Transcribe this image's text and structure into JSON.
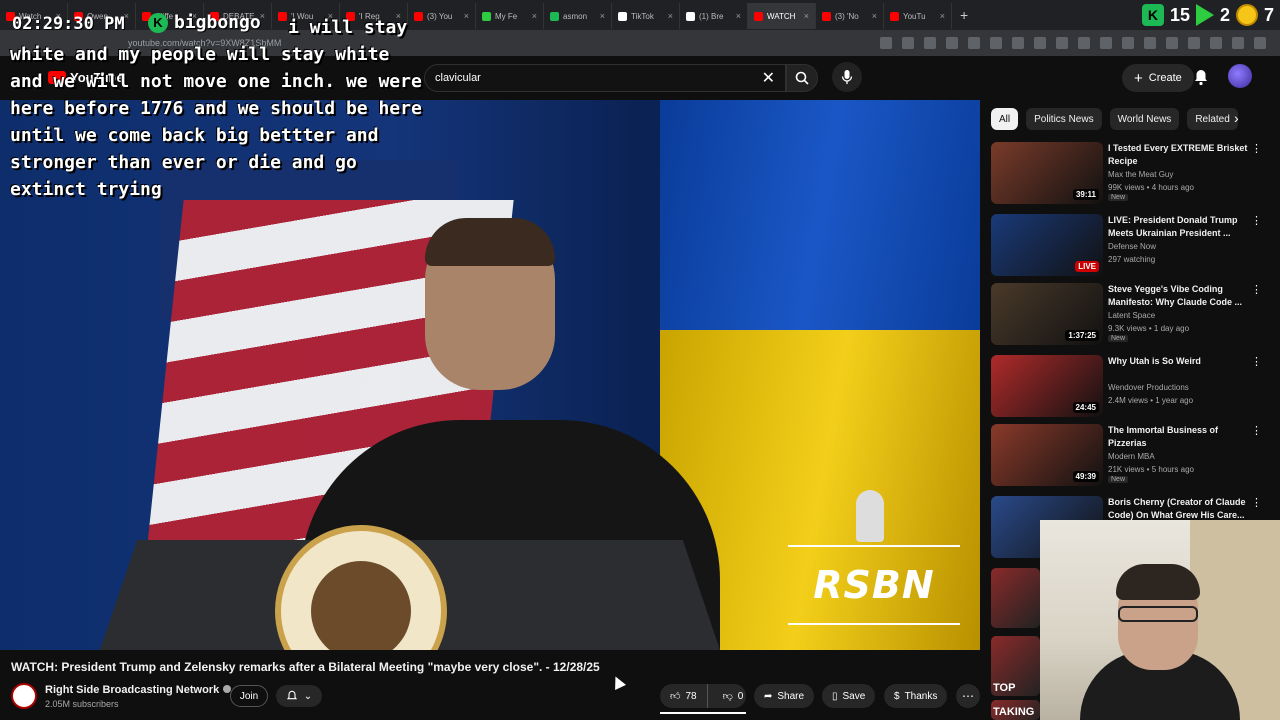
{
  "browser": {
    "tabs": [
      {
        "label": "Watch",
        "color": "#ff0000"
      },
      {
        "label": "Owen",
        "color": "#ff0000"
      },
      {
        "label": "Cliffe",
        "color": "#ff0000"
      },
      {
        "label": "DEBATE",
        "color": "#ff0000"
      },
      {
        "label": "'I Wou",
        "color": "#ff0000"
      },
      {
        "label": "'I Reg",
        "color": "#ff0000"
      },
      {
        "label": "(3) You",
        "color": "#ff0000"
      },
      {
        "label": "My Fe",
        "color": "#2ecc40"
      },
      {
        "label": "asmon",
        "color": "#1db954"
      },
      {
        "label": "TikTok",
        "color": "#ffffff"
      },
      {
        "label": "(1) Bre",
        "color": "#ffffff"
      },
      {
        "label": "WATCH",
        "color": "#ff0000"
      },
      {
        "label": "(3) 'No",
        "color": "#ff0000"
      },
      {
        "label": "YouTu",
        "color": "#ff0000"
      }
    ],
    "active_tab_index": 11,
    "url": "youtube.com/watch?v=9XW8Z1SbMM",
    "ext_badge_1": "15",
    "ext_badge_2": "2",
    "ext_badge_3": "7"
  },
  "overlay": {
    "clock": "02:29:30 PM",
    "chat_username": "bigbongo",
    "chat_message": "i will stay white and my people will stay white and we will not move one inch. we were here before 1776 and we should be here until we come back big bettter and stronger than ever or die and go extinct trying"
  },
  "youtube": {
    "logo_text": "YouTube",
    "search_value": "clavicular",
    "create_label": "Create"
  },
  "video": {
    "watermark": "RSBN",
    "title": "WATCH: President Trump and Zelensky remarks after a Bilateral Meeting \"maybe very close\". - 12/28/25",
    "channel_name": "Right Side Broadcasting Network",
    "subscribers": "2.05M subscribers",
    "join_label": "Join",
    "like_count": "78",
    "dislike_count": "0",
    "share_label": "Share",
    "save_label": "Save",
    "thanks_label": "Thanks"
  },
  "chips": [
    "All",
    "Politics News",
    "World News",
    "Related"
  ],
  "recommendations": [
    {
      "title": "I Tested Every EXTREME Brisket Recipe",
      "channel": "Max the Meat Guy",
      "meta": "99K views • 4 hours ago",
      "badge": "New",
      "duration": "39:11",
      "thumb_color": "#7a3b2a"
    },
    {
      "title": "LIVE: President Donald Trump Meets Ukrainian President ...",
      "channel": "Defense Now",
      "meta": "297 watching",
      "badge": "",
      "duration": "LIVE",
      "thumb_color": "#1a3a7a"
    },
    {
      "title": "Steve Yegge's Vibe Coding Manifesto: Why Claude Code ...",
      "channel": "Latent Space",
      "meta": "9.3K views • 1 day ago",
      "badge": "New",
      "duration": "1:37:25",
      "thumb_color": "#4a3a2a"
    },
    {
      "title": "Why Utah is So Weird",
      "channel": "Wendover Productions",
      "meta": "2.4M views • 1 year ago",
      "badge": "",
      "duration": "24:45",
      "thumb_color": "#b02a2a"
    },
    {
      "title": "The Immortal Business of Pizzerias",
      "channel": "Modern MBA",
      "meta": "21K views • 5 hours ago",
      "badge": "New",
      "duration": "49:39",
      "thumb_color": "#8a3a2a"
    },
    {
      "title": "Boris Cherny (Creator of Claude Code) On What Grew His Care...",
      "channel": "",
      "meta": "",
      "badge": "",
      "duration": "",
      "thumb_color": "#2a4a8a"
    }
  ],
  "extra_thumb_labels": [
    "TOP",
    "TAKING"
  ]
}
